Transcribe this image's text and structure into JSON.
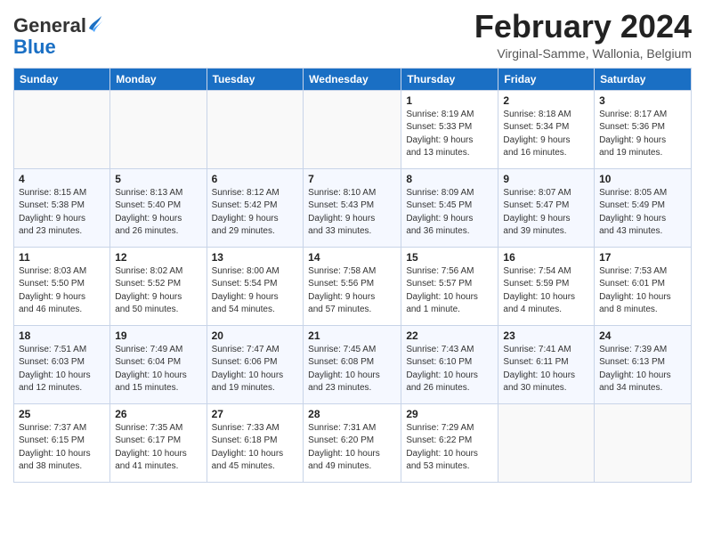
{
  "logo": {
    "general": "General",
    "blue": "Blue"
  },
  "header": {
    "month_year": "February 2024",
    "location": "Virginal-Samme, Wallonia, Belgium"
  },
  "weekdays": [
    "Sunday",
    "Monday",
    "Tuesday",
    "Wednesday",
    "Thursday",
    "Friday",
    "Saturday"
  ],
  "weeks": [
    [
      {
        "day": "",
        "info": ""
      },
      {
        "day": "",
        "info": ""
      },
      {
        "day": "",
        "info": ""
      },
      {
        "day": "",
        "info": ""
      },
      {
        "day": "1",
        "info": "Sunrise: 8:19 AM\nSunset: 5:33 PM\nDaylight: 9 hours\nand 13 minutes."
      },
      {
        "day": "2",
        "info": "Sunrise: 8:18 AM\nSunset: 5:34 PM\nDaylight: 9 hours\nand 16 minutes."
      },
      {
        "day": "3",
        "info": "Sunrise: 8:17 AM\nSunset: 5:36 PM\nDaylight: 9 hours\nand 19 minutes."
      }
    ],
    [
      {
        "day": "4",
        "info": "Sunrise: 8:15 AM\nSunset: 5:38 PM\nDaylight: 9 hours\nand 23 minutes."
      },
      {
        "day": "5",
        "info": "Sunrise: 8:13 AM\nSunset: 5:40 PM\nDaylight: 9 hours\nand 26 minutes."
      },
      {
        "day": "6",
        "info": "Sunrise: 8:12 AM\nSunset: 5:42 PM\nDaylight: 9 hours\nand 29 minutes."
      },
      {
        "day": "7",
        "info": "Sunrise: 8:10 AM\nSunset: 5:43 PM\nDaylight: 9 hours\nand 33 minutes."
      },
      {
        "day": "8",
        "info": "Sunrise: 8:09 AM\nSunset: 5:45 PM\nDaylight: 9 hours\nand 36 minutes."
      },
      {
        "day": "9",
        "info": "Sunrise: 8:07 AM\nSunset: 5:47 PM\nDaylight: 9 hours\nand 39 minutes."
      },
      {
        "day": "10",
        "info": "Sunrise: 8:05 AM\nSunset: 5:49 PM\nDaylight: 9 hours\nand 43 minutes."
      }
    ],
    [
      {
        "day": "11",
        "info": "Sunrise: 8:03 AM\nSunset: 5:50 PM\nDaylight: 9 hours\nand 46 minutes."
      },
      {
        "day": "12",
        "info": "Sunrise: 8:02 AM\nSunset: 5:52 PM\nDaylight: 9 hours\nand 50 minutes."
      },
      {
        "day": "13",
        "info": "Sunrise: 8:00 AM\nSunset: 5:54 PM\nDaylight: 9 hours\nand 54 minutes."
      },
      {
        "day": "14",
        "info": "Sunrise: 7:58 AM\nSunset: 5:56 PM\nDaylight: 9 hours\nand 57 minutes."
      },
      {
        "day": "15",
        "info": "Sunrise: 7:56 AM\nSunset: 5:57 PM\nDaylight: 10 hours\nand 1 minute."
      },
      {
        "day": "16",
        "info": "Sunrise: 7:54 AM\nSunset: 5:59 PM\nDaylight: 10 hours\nand 4 minutes."
      },
      {
        "day": "17",
        "info": "Sunrise: 7:53 AM\nSunset: 6:01 PM\nDaylight: 10 hours\nand 8 minutes."
      }
    ],
    [
      {
        "day": "18",
        "info": "Sunrise: 7:51 AM\nSunset: 6:03 PM\nDaylight: 10 hours\nand 12 minutes."
      },
      {
        "day": "19",
        "info": "Sunrise: 7:49 AM\nSunset: 6:04 PM\nDaylight: 10 hours\nand 15 minutes."
      },
      {
        "day": "20",
        "info": "Sunrise: 7:47 AM\nSunset: 6:06 PM\nDaylight: 10 hours\nand 19 minutes."
      },
      {
        "day": "21",
        "info": "Sunrise: 7:45 AM\nSunset: 6:08 PM\nDaylight: 10 hours\nand 23 minutes."
      },
      {
        "day": "22",
        "info": "Sunrise: 7:43 AM\nSunset: 6:10 PM\nDaylight: 10 hours\nand 26 minutes."
      },
      {
        "day": "23",
        "info": "Sunrise: 7:41 AM\nSunset: 6:11 PM\nDaylight: 10 hours\nand 30 minutes."
      },
      {
        "day": "24",
        "info": "Sunrise: 7:39 AM\nSunset: 6:13 PM\nDaylight: 10 hours\nand 34 minutes."
      }
    ],
    [
      {
        "day": "25",
        "info": "Sunrise: 7:37 AM\nSunset: 6:15 PM\nDaylight: 10 hours\nand 38 minutes."
      },
      {
        "day": "26",
        "info": "Sunrise: 7:35 AM\nSunset: 6:17 PM\nDaylight: 10 hours\nand 41 minutes."
      },
      {
        "day": "27",
        "info": "Sunrise: 7:33 AM\nSunset: 6:18 PM\nDaylight: 10 hours\nand 45 minutes."
      },
      {
        "day": "28",
        "info": "Sunrise: 7:31 AM\nSunset: 6:20 PM\nDaylight: 10 hours\nand 49 minutes."
      },
      {
        "day": "29",
        "info": "Sunrise: 7:29 AM\nSunset: 6:22 PM\nDaylight: 10 hours\nand 53 minutes."
      },
      {
        "day": "",
        "info": ""
      },
      {
        "day": "",
        "info": ""
      }
    ]
  ]
}
